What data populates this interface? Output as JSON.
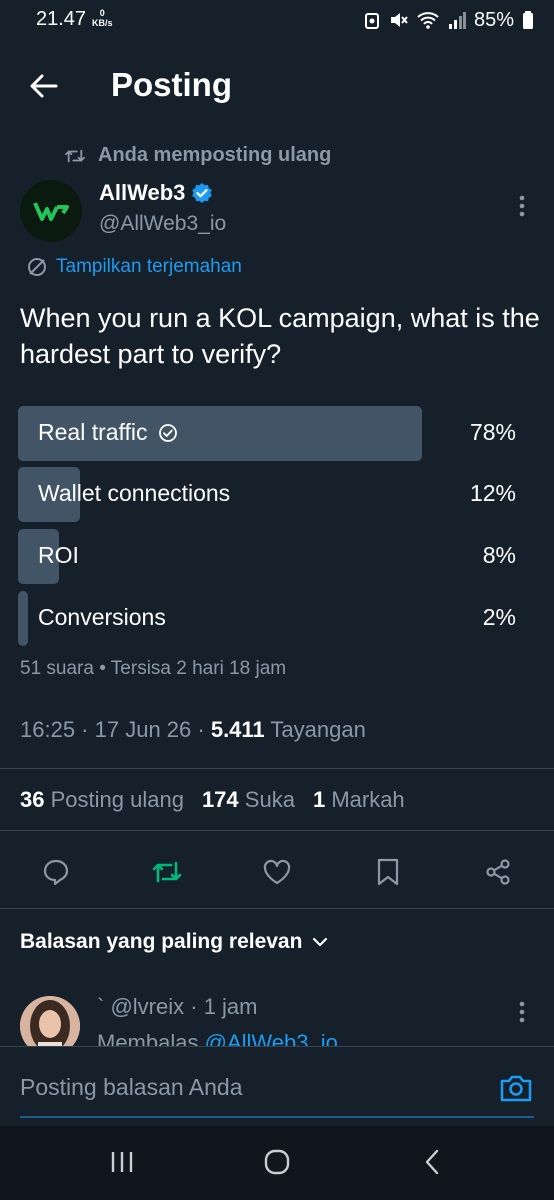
{
  "status_bar": {
    "time": "21.47",
    "net_speed_value": "0",
    "net_speed_unit": "KB/s",
    "battery": "85%"
  },
  "header": {
    "title": "Posting"
  },
  "repost_note": "Anda memposting ulang",
  "author": {
    "name": "AllWeb3",
    "handle": "@AllWeb3_io",
    "verified": true,
    "avatar_color": "#22c55e"
  },
  "translate_link": "Tampilkan terjemahan",
  "tweet_text": "When you run a KOL campaign, what is the hardest part to verify?",
  "poll": {
    "options": [
      {
        "label": "Real traffic",
        "percent": "78%",
        "fraction": 0.78,
        "selected": true
      },
      {
        "label": "Wallet connections",
        "percent": "12%",
        "fraction": 0.12,
        "selected": false
      },
      {
        "label": "ROI",
        "percent": "8%",
        "fraction": 0.08,
        "selected": false
      },
      {
        "label": "Conversions",
        "percent": "2%",
        "fraction": 0.02,
        "selected": false
      }
    ],
    "meta": "51 suara • Tersisa 2 hari 18 jam"
  },
  "timestamp": {
    "time": "16:25",
    "date": "17 Jun 26",
    "views_count": "5.411",
    "views_label": "Tayangan"
  },
  "stats": {
    "reposts_count": "36",
    "reposts_label": "Posting ulang",
    "likes_count": "174",
    "likes_label": "Suka",
    "bookmarks_count": "1",
    "bookmarks_label": "Markah"
  },
  "sort_label": "Balasan yang paling relevan",
  "reply": {
    "prefix": "`",
    "handle": "@lvreix",
    "time": "1 jam",
    "replying_prefix": "Membalas",
    "replying_to": "@AllWeb3_io"
  },
  "composer_placeholder": "Posting balasan Anda",
  "colors": {
    "accent": "#1d9bf0",
    "repost_active": "#00ba7c",
    "background": "#15202b"
  }
}
